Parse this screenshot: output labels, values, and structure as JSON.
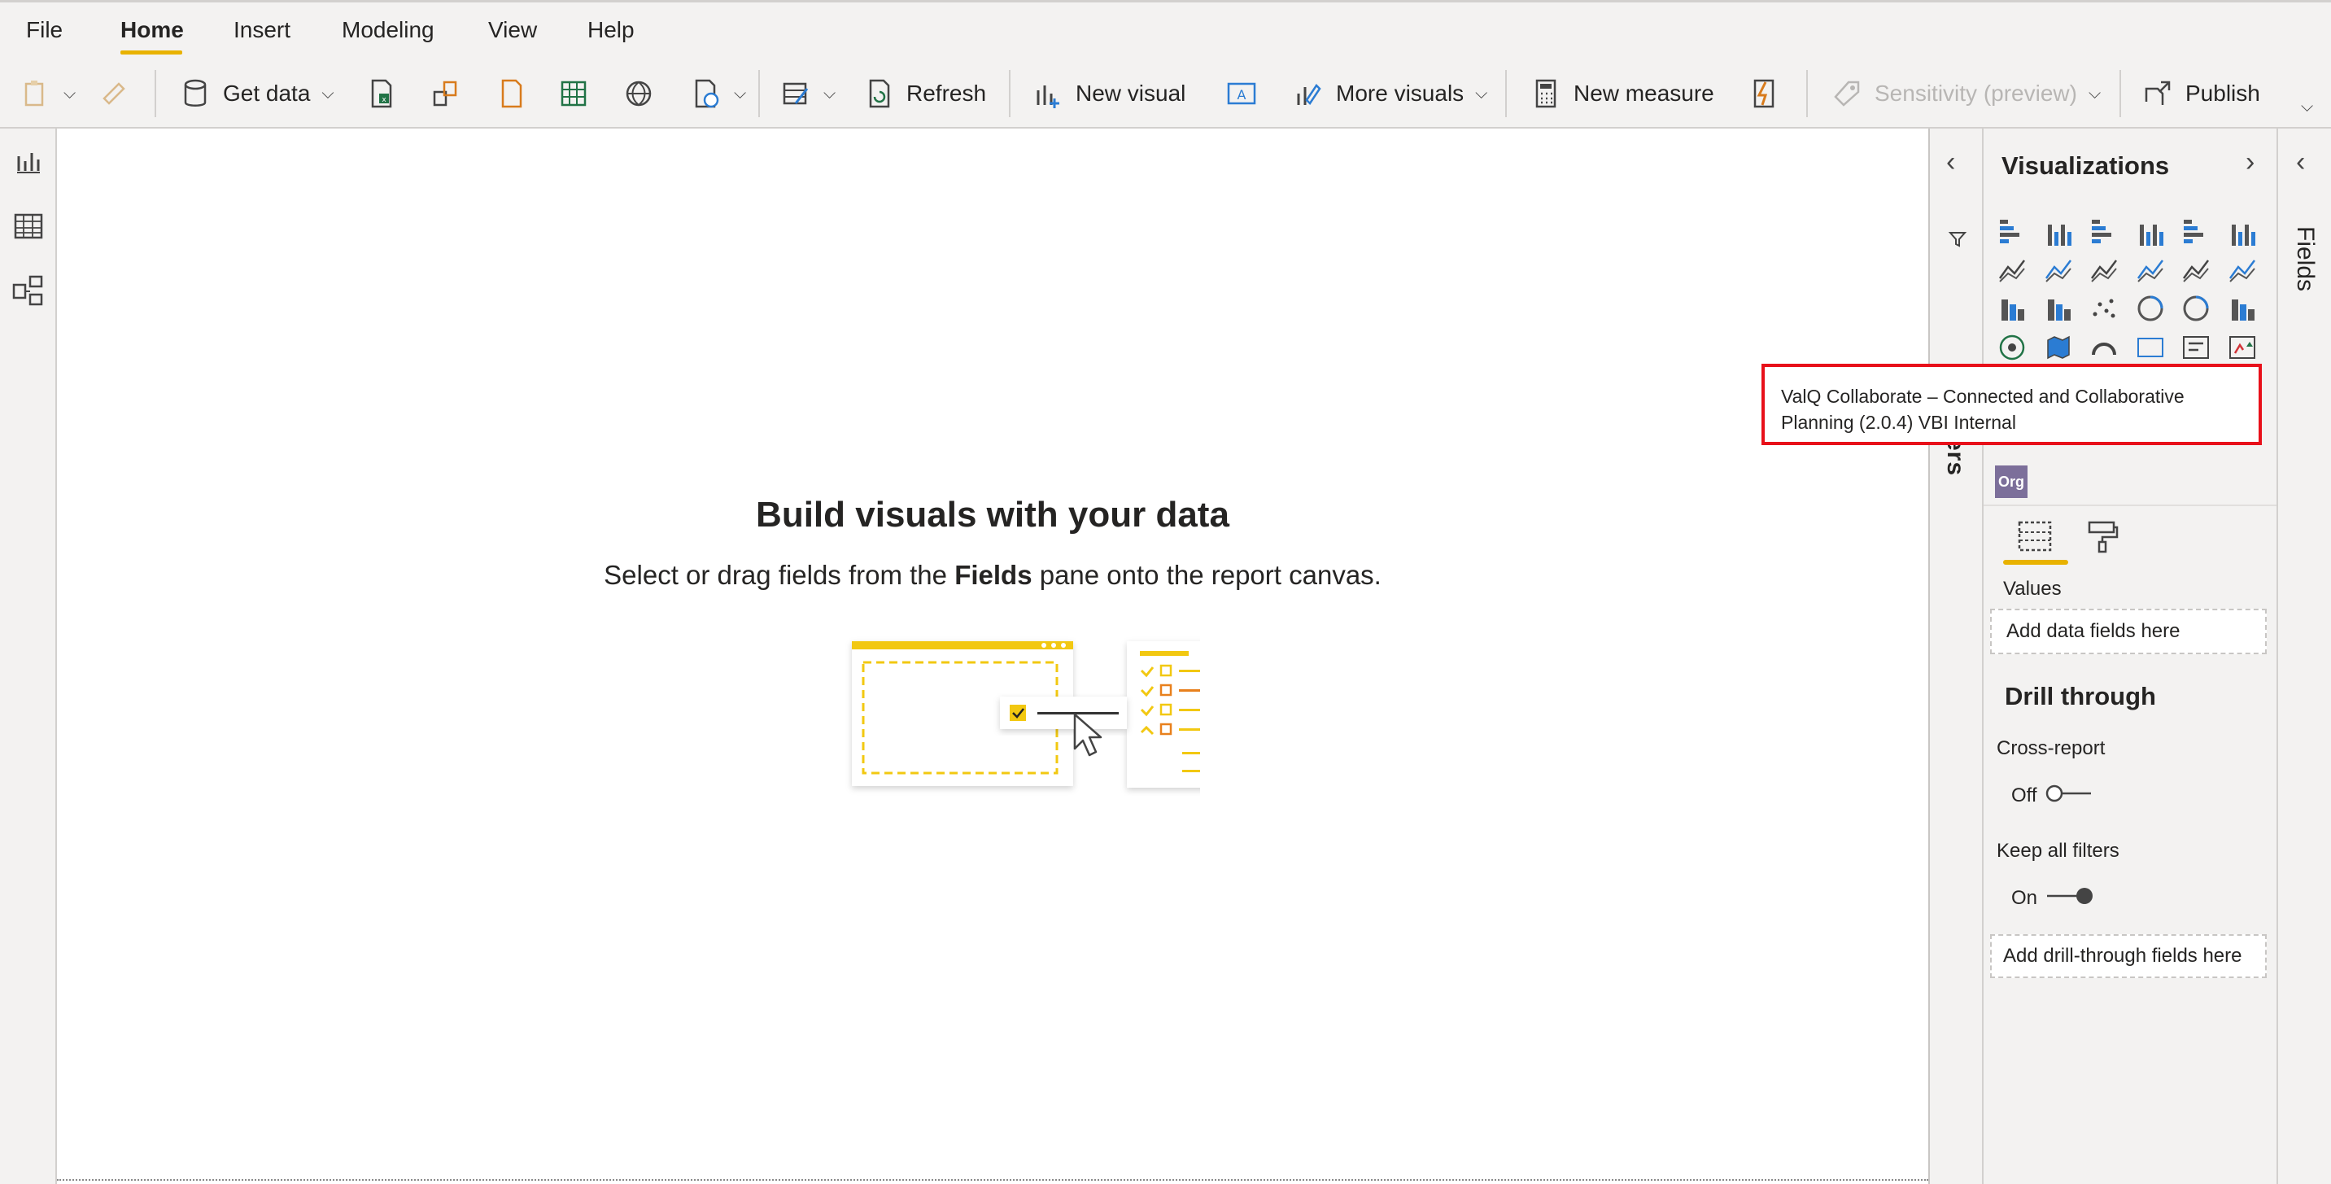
{
  "menu": {
    "tabs": [
      "File",
      "Home",
      "Insert",
      "Modeling",
      "View",
      "Help"
    ],
    "active_tab": "Home"
  },
  "toolbar": {
    "get_data": "Get data",
    "refresh": "Refresh",
    "new_visual": "New visual",
    "more_visuals": "More visuals",
    "new_measure": "New measure",
    "sensitivity": "Sensitivity (preview)",
    "publish": "Publish"
  },
  "canvas": {
    "title": "Build visuals with your data",
    "subtitle_pre": "Select or drag fields from the ",
    "subtitle_bold": "Fields",
    "subtitle_post": " pane onto the report canvas."
  },
  "filters": {
    "label": "Filters"
  },
  "visualizations": {
    "title": "Visualizations",
    "values_label": "Values",
    "values_placeholder": "Add data fields here",
    "drill_title": "Drill through",
    "cross_report_label": "Cross-report",
    "cross_report_state": "Off",
    "keep_filters_label": "Keep all filters",
    "keep_filters_state": "On",
    "drill_placeholder": "Add drill-through fields here",
    "custom_visual_badge": "Org"
  },
  "fields": {
    "label": "Fields"
  },
  "tooltip": {
    "line1": "ValQ Collaborate – Connected and Collaborative",
    "line2": "Planning (2.0.4) VBI Internal"
  },
  "colors": {
    "accent": "#e8b200",
    "tooltip_border": "#e8101a",
    "chrome": "#f3f2f1"
  }
}
